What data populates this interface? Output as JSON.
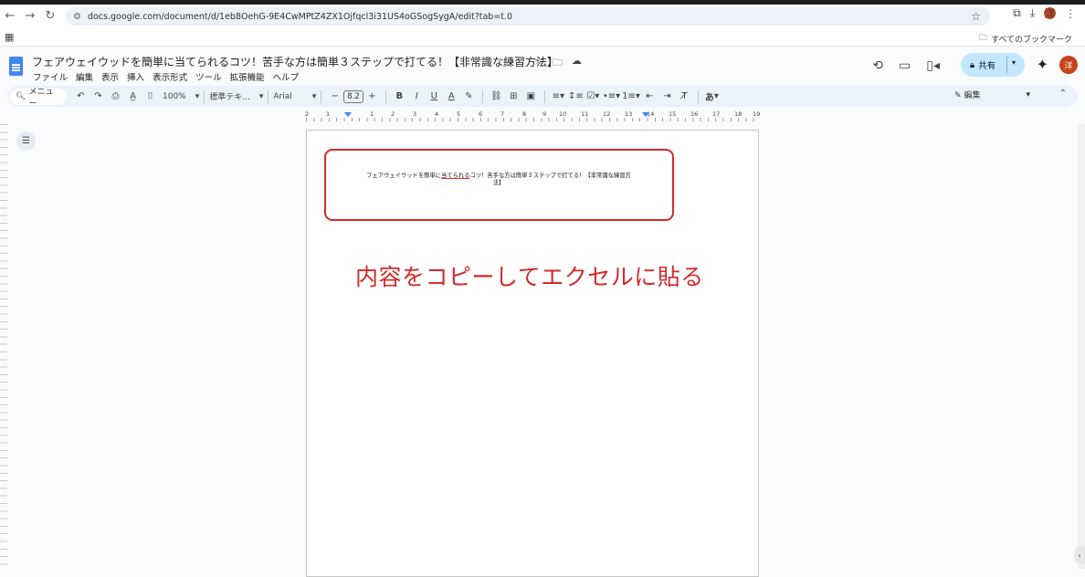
{
  "browser": {
    "url": "docs.google.com/document/d/1eb8OehG-9E4CwMPtZ4ZX1Ojfqcl3i31US4oGSogSygA/edit?tab=t.0",
    "all_bookmarks_label": "すべてのブックマーク",
    "profile_initial": "洋"
  },
  "doc": {
    "title": "フェアウェイウッドを簡単に当てられるコツ！苦手な方は簡単３ステップで打てる！【非常識な練習方法】",
    "menu": [
      "ファイル",
      "編集",
      "表示",
      "挿入",
      "表示形式",
      "ツール",
      "拡張機能",
      "ヘルプ"
    ],
    "share_label": "共有",
    "avatar_initial": "洋"
  },
  "toolbar": {
    "search_label": "メニュー",
    "zoom": "100%",
    "style": "標準テキ...",
    "font": "Arial",
    "font_size": "8.2",
    "input_mode": "あ",
    "edit_mode": "編集"
  },
  "ruler": {
    "numbers": [
      "2",
      "1",
      "1",
      "2",
      "3",
      "4",
      "5",
      "6",
      "7",
      "8",
      "9",
      "10",
      "11",
      "12",
      "13",
      "14",
      "15",
      "16",
      "17",
      "18",
      "19"
    ]
  },
  "content": {
    "line_part1": "フェアウェイウッドを簡単に",
    "line_part2": "当てられる",
    "line_part3": "コツ！苦手な方は簡単３ステップで打てる！【非常識な練習方",
    "line_part4": "法】",
    "annotation": "内容をコピーしてエクセルに貼る"
  },
  "colors": {
    "annotation": "#d22a2a",
    "share_bg": "#c2e7ff",
    "docs_blue": "#4285f4",
    "avatar": "#c7431a"
  }
}
